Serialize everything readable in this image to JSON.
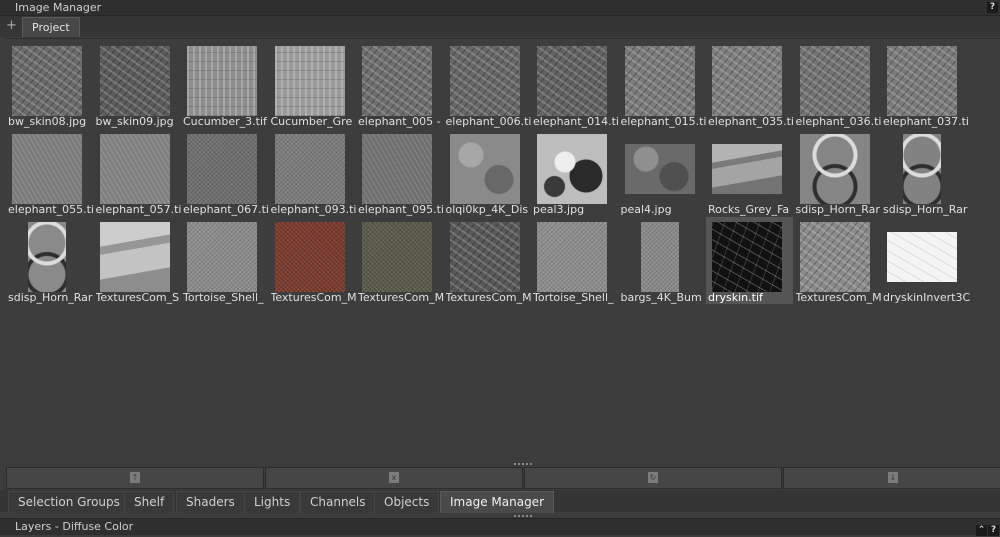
{
  "window": {
    "title": "Image Manager"
  },
  "top_tabs": [
    {
      "label": "Project"
    }
  ],
  "images": [
    {
      "label": "bw_skin08.jpg",
      "tone": "#6a6a6a",
      "pattern": "crack"
    },
    {
      "label": "bw_skin09.jpg",
      "tone": "#5c5c5c",
      "pattern": "crack"
    },
    {
      "label": "Cucumber_3.tif",
      "tone": "#8e8e8e",
      "pattern": "vert"
    },
    {
      "label": "Cucumber_Gre",
      "tone": "#9a9a9a",
      "pattern": "vert"
    },
    {
      "label": "elephant_005 -",
      "tone": "#6e6e6e",
      "pattern": "crack"
    },
    {
      "label": "elephant_006.ti",
      "tone": "#666666",
      "pattern": "crack"
    },
    {
      "label": "elephant_014.ti",
      "tone": "#626262",
      "pattern": "crack"
    },
    {
      "label": "elephant_015.ti",
      "tone": "#7a7a7a",
      "pattern": "crack"
    },
    {
      "label": "elephant_035.ti",
      "tone": "#7e7e7e",
      "pattern": "crack"
    },
    {
      "label": "elephant_036.ti",
      "tone": "#737373",
      "pattern": "crack"
    },
    {
      "label": "elephant_037.ti",
      "tone": "#7a7a7a",
      "pattern": "crack"
    },
    {
      "label": "elephant_055.ti",
      "tone": "#7b7b7b",
      "pattern": "diag"
    },
    {
      "label": "elephant_057.ti",
      "tone": "#808080",
      "pattern": "diag"
    },
    {
      "label": "elephant_067.ti",
      "tone": "#6f6f6f",
      "pattern": "noise"
    },
    {
      "label": "elephant_093.ti",
      "tone": "#7c7c7c",
      "pattern": "noise"
    },
    {
      "label": "elephant_095.ti",
      "tone": "#707070",
      "pattern": "diag"
    },
    {
      "label": "olqi0kp_4K_Dis",
      "tone": "#8a8a8a",
      "pattern": "blob"
    },
    {
      "label": "peal3.jpg",
      "tone": "#bdbdbd",
      "pattern": "peal"
    },
    {
      "label": "peal4.jpg",
      "tone": "#6a6a6a",
      "pattern": "blob",
      "short": true
    },
    {
      "label": "Rocks_Grey_Fa",
      "tone": "#9a9a9a",
      "pattern": "rock",
      "short": true
    },
    {
      "label": "sdisp_Horn_Rar",
      "tone": "#858585",
      "pattern": "horn"
    },
    {
      "label": "sdisp_Horn_Rar",
      "tone": "#828282",
      "pattern": "horn",
      "narrow": true
    },
    {
      "label": "sdisp_Horn_Rar",
      "tone": "#8a8a8a",
      "pattern": "horn",
      "narrow": true
    },
    {
      "label": "TexturesCom_S",
      "tone": "#bcbcbc",
      "pattern": "rock"
    },
    {
      "label": "Tortoise_Shell_",
      "tone": "#8c8c8c",
      "pattern": "noise"
    },
    {
      "label": "TexturesCom_M",
      "tone": "#7a3a2e",
      "pattern": "noise"
    },
    {
      "label": "TexturesCom_M",
      "tone": "#5a5a48",
      "pattern": "noise"
    },
    {
      "label": "TexturesCom_M",
      "tone": "#585858",
      "pattern": "crack"
    },
    {
      "label": "Tortoise_Shell_",
      "tone": "#8e8e8e",
      "pattern": "noise"
    },
    {
      "label": "bargs_4K_Bum",
      "tone": "#8a8a8a",
      "pattern": "noise",
      "narrow": true
    },
    {
      "label": "dryskin.tif",
      "tone": "#111111",
      "pattern": "dark",
      "selected": true
    },
    {
      "label": "TexturesCom_M",
      "tone": "#8a8a8a",
      "pattern": "crack"
    },
    {
      "label": "dryskinInvert3C",
      "tone": "#f4f4f4",
      "pattern": "light",
      "short": true
    }
  ],
  "toolbar": [
    {
      "icon": "import-icon",
      "glyph": "↑"
    },
    {
      "icon": "remove-icon",
      "glyph": "x"
    },
    {
      "icon": "reload-icon",
      "glyph": "↻"
    },
    {
      "icon": "export-icon",
      "glyph": "↓"
    }
  ],
  "bottom_tabs": [
    {
      "label": "Selection Groups"
    },
    {
      "label": "Shelf"
    },
    {
      "label": "Shaders"
    },
    {
      "label": "Lights"
    },
    {
      "label": "Channels"
    },
    {
      "label": "Objects"
    },
    {
      "label": "Image Manager",
      "active": true
    }
  ],
  "layers_panel": {
    "title": "Layers - Diffuse Color"
  },
  "help_glyph": "?"
}
